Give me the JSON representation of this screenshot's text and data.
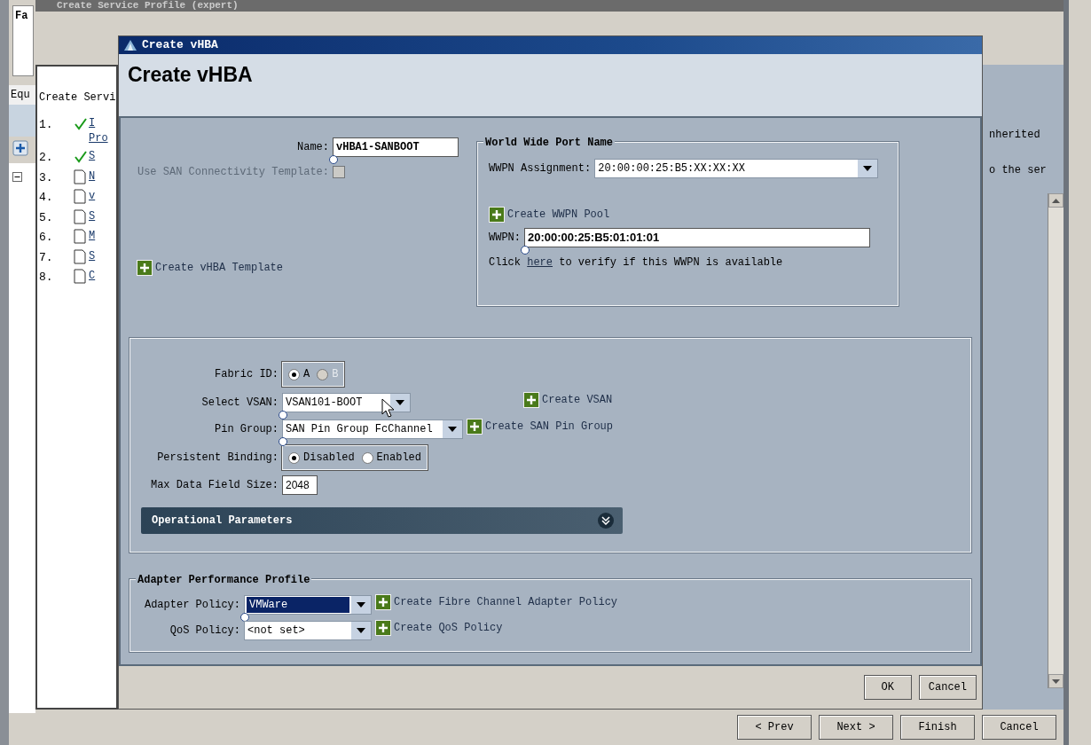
{
  "background_window": {
    "title": "Create Service Profile (expert)",
    "side_group_label": "Fa",
    "side_tab": "Equ",
    "nav_heading": "Create Servi",
    "steps": [
      {
        "number": "1.",
        "done": true,
        "label_lines": [
          "I",
          "Pro"
        ]
      },
      {
        "number": "2.",
        "done": true,
        "label_lines": [
          "S"
        ]
      },
      {
        "number": "3.",
        "done": false,
        "label_lines": [
          "N"
        ]
      },
      {
        "number": "4.",
        "done": false,
        "label_lines": [
          "v"
        ]
      },
      {
        "number": "5.",
        "done": false,
        "label_lines": [
          "S"
        ]
      },
      {
        "number": "6.",
        "done": false,
        "label_lines": [
          "M"
        ]
      },
      {
        "number": "7.",
        "done": false,
        "label_lines": [
          "S"
        ]
      },
      {
        "number": "8.",
        "done": false,
        "label_lines": [
          "C"
        ]
      }
    ],
    "content_texts": [
      "nherited",
      "o the ser"
    ],
    "buttons": [
      "< Prev",
      "Next >",
      "Finish",
      "Cancel"
    ]
  },
  "dialog": {
    "title": "Create vHBA",
    "heading": "Create vHBA",
    "name": {
      "label": "Name:",
      "value": "vHBA1-SANBOOT"
    },
    "use_template": {
      "label": "Use SAN Connectivity Template:",
      "checked": false,
      "disabled": true
    },
    "create_template_link": "Create vHBA Template",
    "wwpn_group": {
      "title": "World Wide Port Name",
      "assignment_label": "WWPN Assignment:",
      "assignment_value": "20:00:00:25:B5:XX:XX:XX",
      "create_pool_link": "Create WWPN Pool",
      "wwpn_label": "WWPN:",
      "wwpn_value": "20:00:00:25:B5:01:01:01",
      "verify_before": "Click",
      "verify_link": "here",
      "verify_after": "to verify if this WWPN is available"
    },
    "fabric_id": {
      "label": "Fabric ID:",
      "options": [
        {
          "label": "A",
          "selected": true,
          "disabled": false
        },
        {
          "label": "B",
          "selected": false,
          "disabled": true
        }
      ]
    },
    "select_vsan": {
      "label": "Select VSAN:",
      "value": "VSAN101-BOOT",
      "link": "Create VSAN"
    },
    "pin_group": {
      "label": "Pin Group:",
      "value": "SAN Pin Group FcChannel",
      "link": "Create SAN Pin Group"
    },
    "persistent_binding": {
      "label": "Persistent Binding:",
      "options": [
        {
          "label": "Disabled",
          "selected": true,
          "disabled": false
        },
        {
          "label": "Enabled",
          "selected": false,
          "disabled": false
        }
      ]
    },
    "max_data_field_size": {
      "label": "Max Data Field Size:",
      "value": "2048"
    },
    "operational_parameters": {
      "title": "Operational Parameters",
      "expanded": false
    },
    "adapter_profile": {
      "title": "Adapter Performance Profile",
      "policies": [
        {
          "label": "Adapter Policy:",
          "value": "VMWare",
          "highlighted": true,
          "link": "Create Fibre Channel Adapter Policy"
        },
        {
          "label": "QoS Policy:",
          "value": "<not set>",
          "highlighted": false,
          "link": "Create QoS Policy"
        }
      ]
    },
    "buttons": [
      "OK",
      "Cancel"
    ]
  }
}
